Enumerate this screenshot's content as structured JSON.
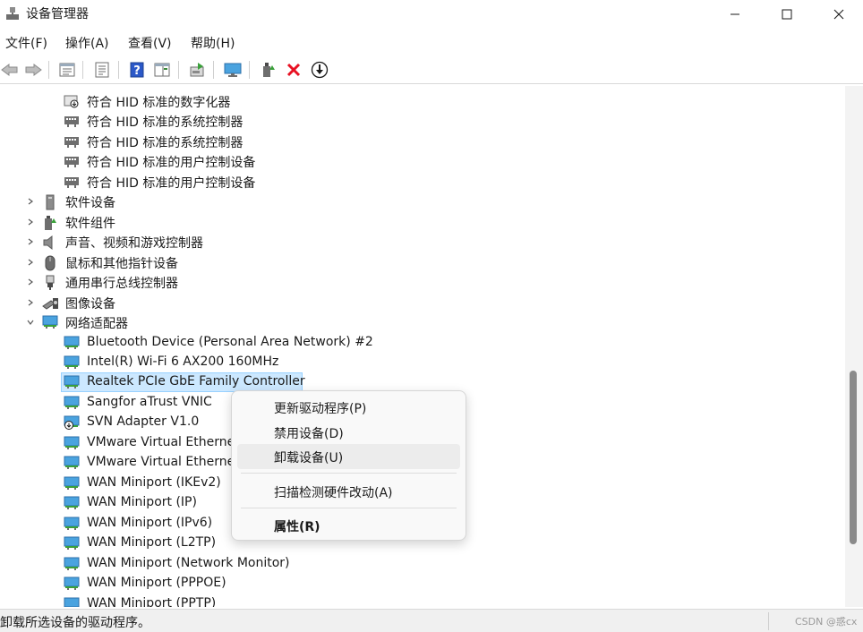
{
  "window": {
    "title": "设备管理器",
    "controls": [
      "minimize-icon",
      "maximize-icon",
      "close-icon"
    ]
  },
  "menubar": {
    "items": [
      {
        "label": "文件(F)"
      },
      {
        "label": "操作(A)"
      },
      {
        "label": "查看(V)"
      },
      {
        "label": "帮助(H)"
      }
    ]
  },
  "toolbar": {
    "buttons": [
      {
        "icon": "back-icon"
      },
      {
        "icon": "forward-icon"
      },
      {
        "icon": "properties-view-icon"
      },
      {
        "icon": "properties-icon"
      },
      {
        "icon": "help-icon"
      },
      {
        "icon": "action-pane-icon"
      },
      {
        "icon": "scan-hardware-icon"
      },
      {
        "icon": "monitor-icon"
      },
      {
        "icon": "update-driver-icon"
      },
      {
        "icon": "uninstall-icon"
      },
      {
        "icon": "download-driver-icon"
      }
    ]
  },
  "tree": {
    "hid_children": [
      {
        "label": "符合 HID 标准的数字化器",
        "icon": "hid-digitizer-icon"
      },
      {
        "label": "符合 HID 标准的系统控制器",
        "icon": "hid-device-icon"
      },
      {
        "label": "符合 HID 标准的系统控制器",
        "icon": "hid-device-icon"
      },
      {
        "label": "符合 HID 标准的用户控制设备",
        "icon": "hid-device-icon"
      },
      {
        "label": "符合 HID 标准的用户控制设备",
        "icon": "hid-device-icon"
      }
    ],
    "categories": [
      {
        "label": "软件设备",
        "icon": "software-device-icon",
        "expanded": false
      },
      {
        "label": "软件组件",
        "icon": "software-component-icon",
        "expanded": false
      },
      {
        "label": "声音、视频和游戏控制器",
        "icon": "speaker-icon",
        "expanded": false
      },
      {
        "label": "鼠标和其他指针设备",
        "icon": "mouse-icon",
        "expanded": false
      },
      {
        "label": "通用串行总线控制器",
        "icon": "usb-icon",
        "expanded": false
      },
      {
        "label": "图像设备",
        "icon": "camera-icon",
        "expanded": false
      },
      {
        "label": "网络适配器",
        "icon": "network-adapter-icon",
        "expanded": true
      }
    ],
    "network_adapters": [
      {
        "label": "Bluetooth Device (Personal Area Network) #2",
        "icon": "network-adapter-icon"
      },
      {
        "label": "Intel(R) Wi-Fi 6 AX200 160MHz",
        "icon": "network-adapter-icon"
      },
      {
        "label": "Realtek PCIe GbE Family Controller",
        "icon": "network-adapter-icon",
        "selected": true
      },
      {
        "label": "Sangfor aTrust VNIC",
        "icon": "network-adapter-icon"
      },
      {
        "label": "SVN Adapter V1.0",
        "icon": "network-adapter-warning-icon"
      },
      {
        "label": "VMware Virtual Etherne",
        "icon": "network-adapter-icon"
      },
      {
        "label": "VMware Virtual Etherne",
        "icon": "network-adapter-icon"
      },
      {
        "label": "WAN Miniport (IKEv2)",
        "icon": "network-adapter-icon"
      },
      {
        "label": "WAN Miniport (IP)",
        "icon": "network-adapter-icon"
      },
      {
        "label": "WAN Miniport (IPv6)",
        "icon": "network-adapter-icon"
      },
      {
        "label": "WAN Miniport (L2TP)",
        "icon": "network-adapter-icon"
      },
      {
        "label": "WAN Miniport (Network Monitor)",
        "icon": "network-adapter-icon"
      },
      {
        "label": "WAN Miniport (PPPOE)",
        "icon": "network-adapter-icon"
      },
      {
        "label": "WAN Miniport (PPTP)",
        "icon": "network-adapter-icon"
      }
    ]
  },
  "context_menu": {
    "items": [
      {
        "label": "更新驱动程序(P)"
      },
      {
        "label": "禁用设备(D)"
      },
      {
        "label": "卸载设备(U)",
        "hovered": true
      },
      {
        "label": "扫描检测硬件改动(A)"
      },
      {
        "label": "属性(R)",
        "bold": true
      }
    ]
  },
  "statusbar": {
    "text": "卸载所选设备的驱动程序。",
    "watermark": "CSDN @惑cx"
  },
  "colors": {
    "selection_bg": "#cce8ff",
    "selection_border": "#99d1ff",
    "delete_red": "#e81123",
    "help_blue": "#2b58c8",
    "network_blue": "#2d8ee0"
  }
}
